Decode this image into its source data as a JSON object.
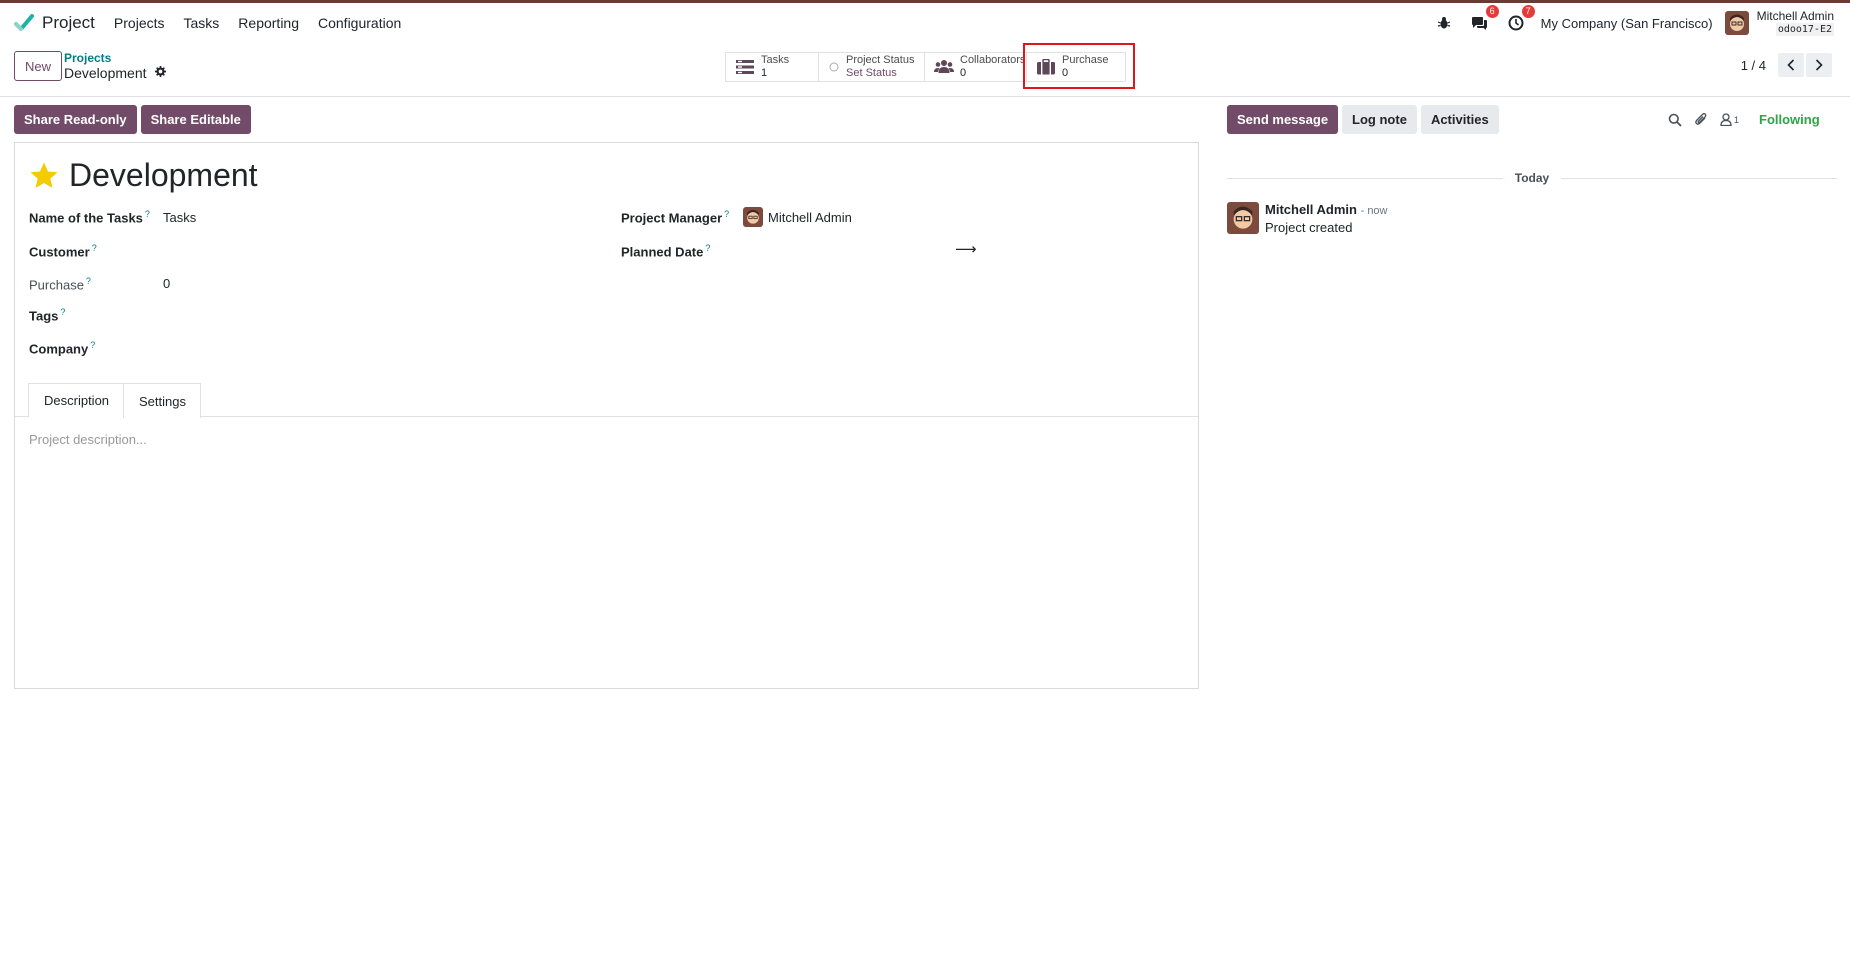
{
  "navbar": {
    "app_name": "Project",
    "menu": [
      "Projects",
      "Tasks",
      "Reporting",
      "Configuration"
    ],
    "messages_badge": "6",
    "activities_badge": "7",
    "company": "My Company (San Francisco)",
    "user_name": "Mitchell Admin",
    "db_name": "odoo17-E2"
  },
  "control": {
    "new_label": "New",
    "breadcrumb_parent": "Projects",
    "breadcrumb_current": "Development",
    "pager": "1 / 4"
  },
  "stats": {
    "tasks": {
      "label": "Tasks",
      "value": "1"
    },
    "status": {
      "label": "Project Status",
      "value": "Set Status"
    },
    "collaborators": {
      "label": "Collaborators",
      "value": "0"
    },
    "purchase": {
      "label": "Purchase",
      "value": "0"
    }
  },
  "actions": {
    "share_readonly": "Share Read-only",
    "share_editable": "Share Editable"
  },
  "form": {
    "title": "Development",
    "fields": {
      "tasks_label": "Name of the Tasks",
      "tasks_value": "Tasks",
      "customer_label": "Customer",
      "purchase_label": "Purchase",
      "purchase_value": "0",
      "tags_label": "Tags",
      "company_label": "Company",
      "pm_label": "Project Manager",
      "pm_value": "Mitchell Admin",
      "planned_label": "Planned Date",
      "help_mark": "?"
    },
    "tabs": [
      "Description",
      "Settings"
    ],
    "description_placeholder": "Project description..."
  },
  "chatter": {
    "send_message": "Send message",
    "log_note": "Log note",
    "activities": "Activities",
    "followers_count": "1",
    "following": "Following",
    "day": "Today",
    "message": {
      "author": "Mitchell Admin",
      "time": "- now",
      "body": "Project created"
    }
  },
  "colors": {
    "primary": "#714b67",
    "link": "#017e84",
    "highlight": "#e3141a",
    "following": "#28a745",
    "star": "#f3cc00"
  }
}
